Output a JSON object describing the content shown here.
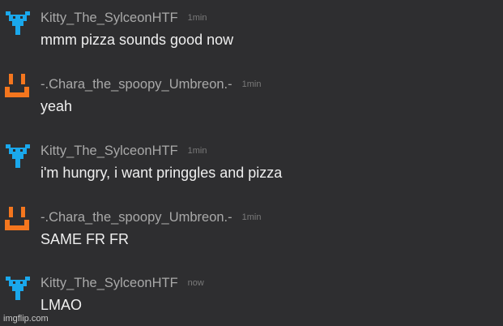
{
  "messages": [
    {
      "username": "Kitty_The_SylceonHTF",
      "time": "1min",
      "text": "mmm pizza sounds good now",
      "avatar": "blue-pixel-face-icon",
      "avatar_color": "#1aa8ec"
    },
    {
      "username": "-.Chara_the_spoopy_Umbreon.-",
      "time": "1min",
      "text": "yeah",
      "avatar": "orange-pixel-face-icon",
      "avatar_color": "#f4761e"
    },
    {
      "username": "Kitty_The_SylceonHTF",
      "time": "1min",
      "text": "i'm hungry, i want pringgles and pizza",
      "avatar": "blue-pixel-face-icon",
      "avatar_color": "#1aa8ec"
    },
    {
      "username": "-.Chara_the_spoopy_Umbreon.-",
      "time": "1min",
      "text": "SAME FR FR",
      "avatar": "orange-pixel-face-icon",
      "avatar_color": "#f4761e"
    },
    {
      "username": "Kitty_The_SylceonHTF",
      "time": "now",
      "text": "LMAO",
      "avatar": "blue-pixel-face-icon",
      "avatar_color": "#1aa8ec"
    }
  ],
  "watermark": "imgflip.com"
}
